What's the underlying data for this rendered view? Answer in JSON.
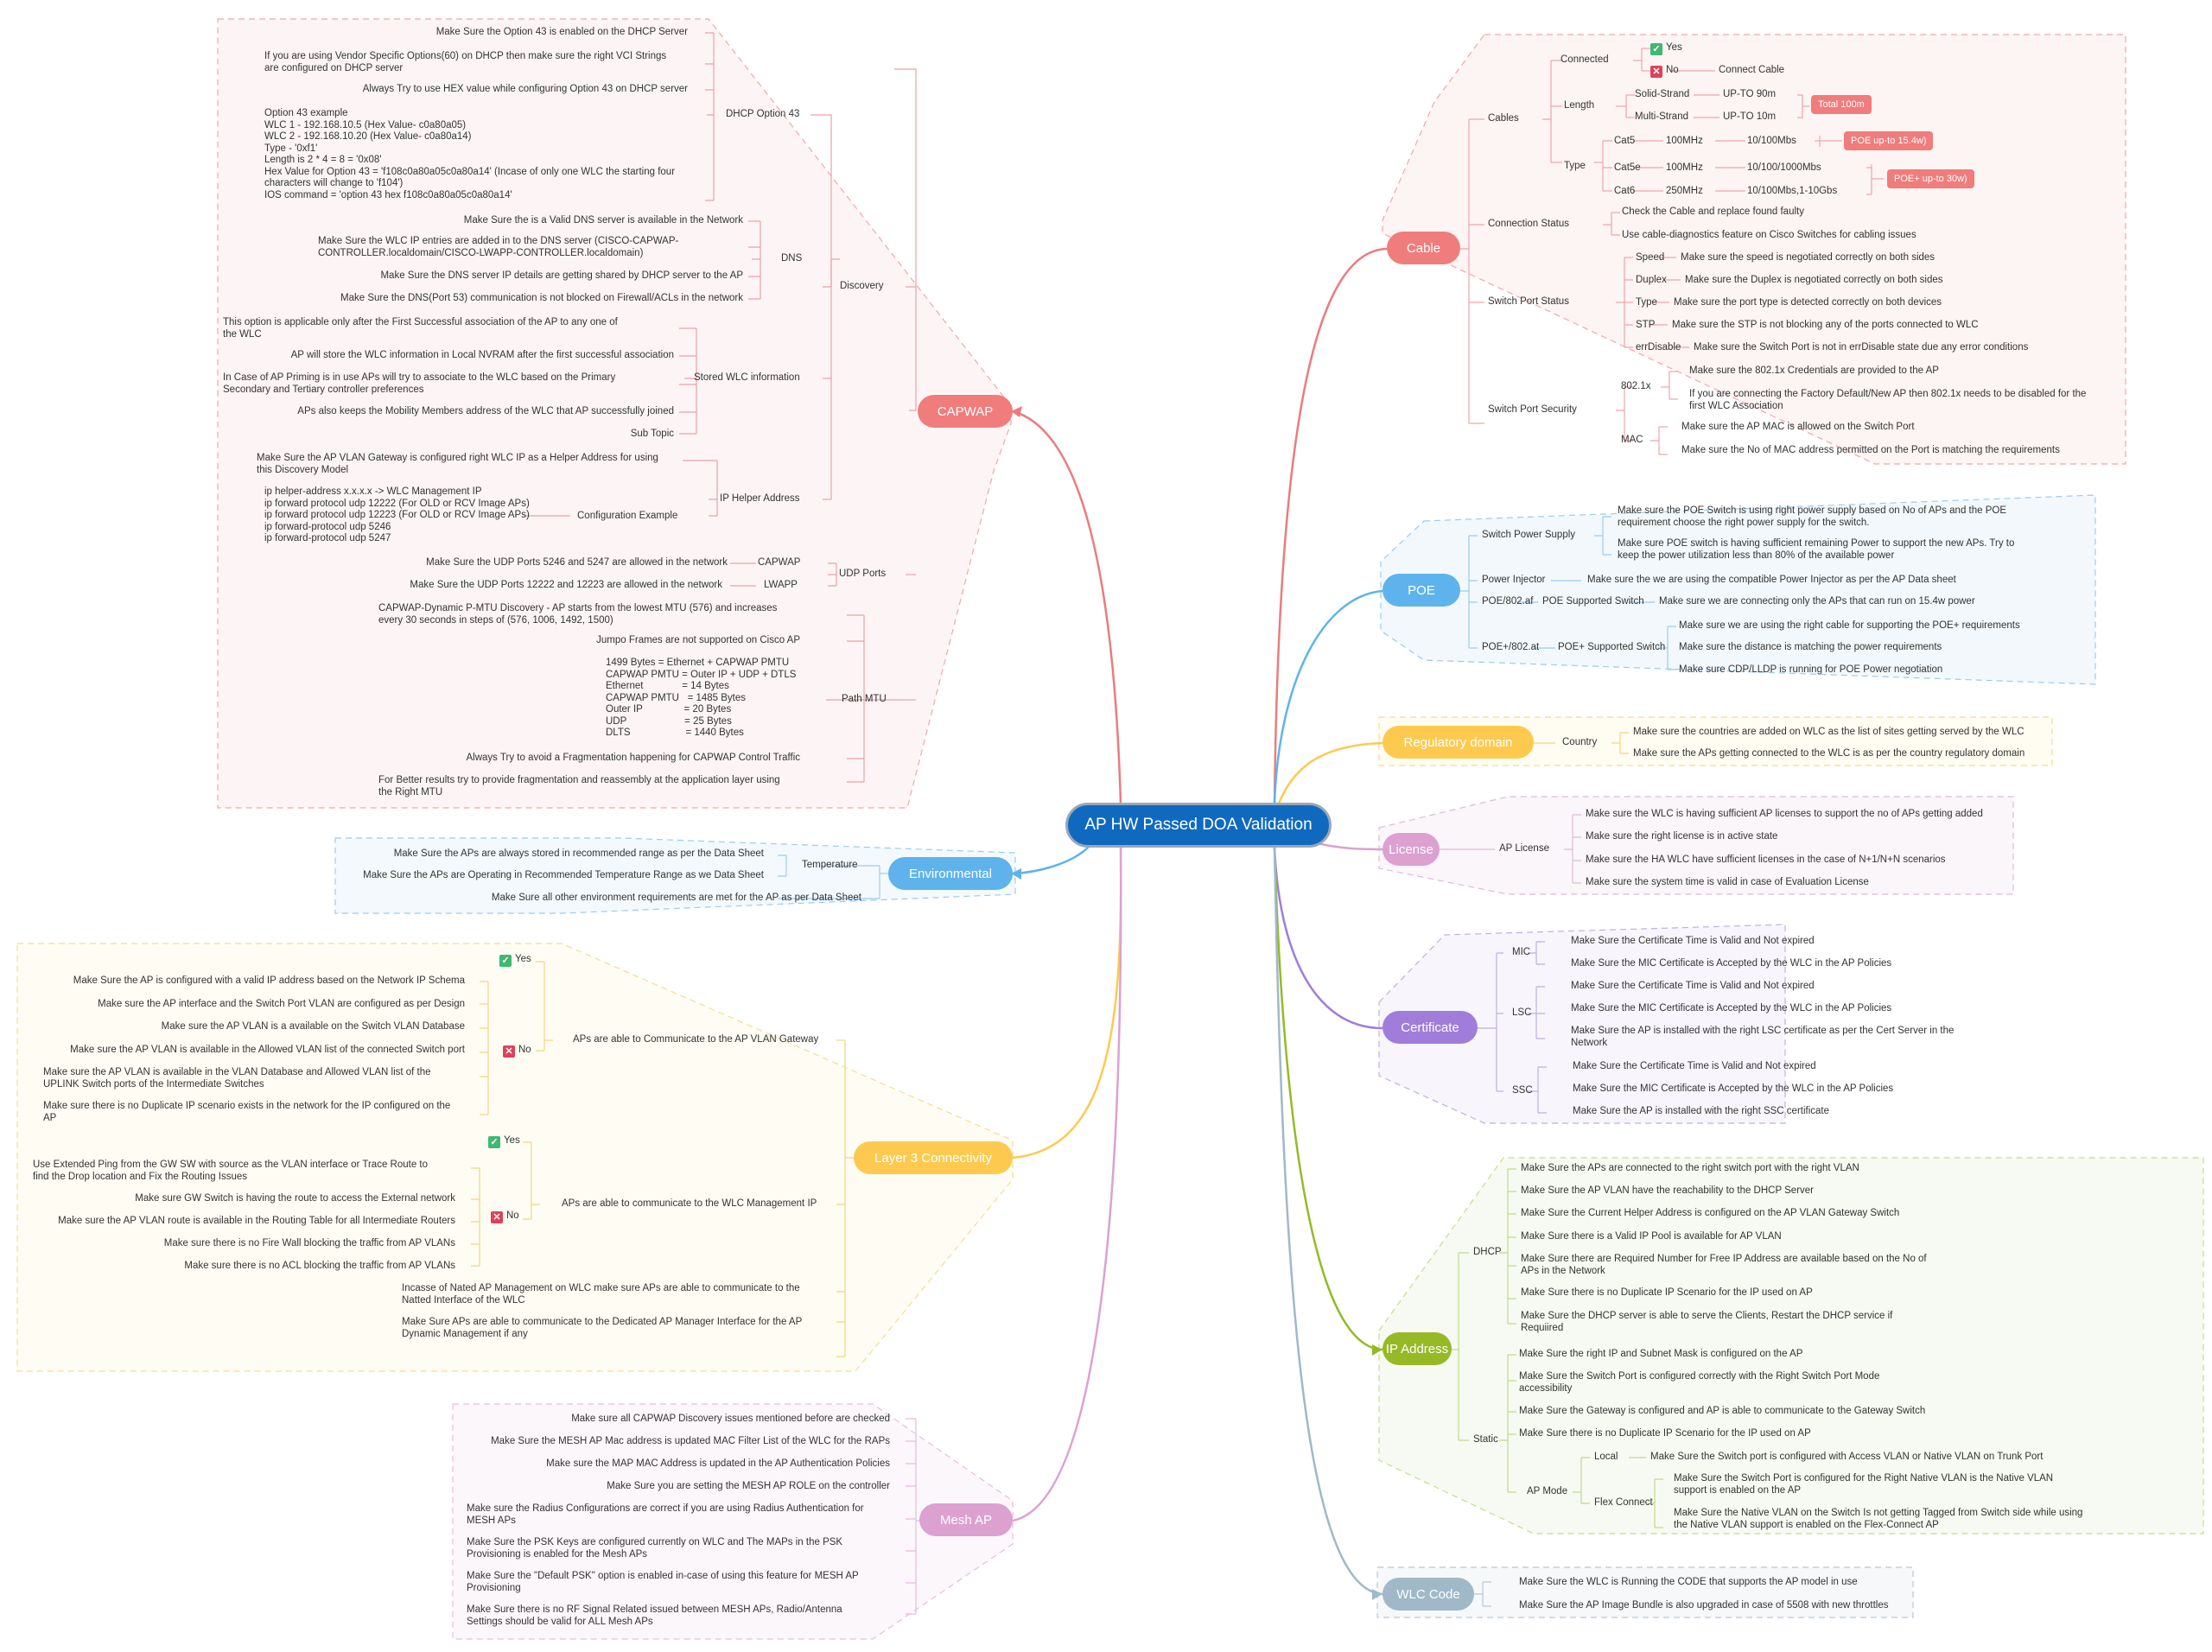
{
  "root": {
    "title": "AP HW Passed DOA Validation"
  },
  "colors": {
    "root": "#0f6abf",
    "capwap": "#f07c7c",
    "environmental": "#5fb3ec",
    "layer3": "#fdca4f",
    "mesh": "#dca1d1",
    "cable": "#f07c7c",
    "poe": "#5fb3ec",
    "regulatory": "#fdca4f",
    "license": "#dca1d1",
    "certificate": "#a07ddb",
    "ip": "#95ba26",
    "wlc": "#9fb9c8"
  },
  "capwap": {
    "label": "CAPWAP",
    "discovery": "Discovery",
    "dhcp43": {
      "label": "DHCP Option 43",
      "items": [
        "Make Sure the Option 43 is enabled on the DHCP Server",
        "If you are using Vendor Specific Options(60) on DHCP then make sure the right VCI Strings\nare configured on DHCP server",
        "Always Try to use HEX value while configuring Option 43 on DHCP server",
        "Option 43 example\nWLC 1 - 192.168.10.5 (Hex Value- c0a80a05)\nWLC 2 - 192.168.10.20 (Hex Value- c0a80a14)\nType - '0xf1'\nLength is 2 * 4 = 8 = '0x08'\nHex Value for Option 43 = 'f108c0a80a05c0a80a14' (Incase of only one WLC the starting four\ncharacters will change to 'f104')\nIOS command = 'option 43 hex f108c0a80a05c0a80a14'"
      ]
    },
    "dns": {
      "label": "DNS",
      "items": [
        "Make Sure the is a Valid DNS server is available in the Network",
        "Make Sure the WLC IP entries are added in to the DNS server (CISCO-CAPWAP-\nCONTROLLER.localdomain/CISCO-LWAPP-CONTROLLER.localdomain)",
        "Make Sure the DNS server IP details are getting shared by DHCP server to the AP",
        "Make Sure the DNS(Port 53) communication is not blocked on Firewall/ACLs in the network"
      ]
    },
    "stored": {
      "label": "Stored WLC information",
      "items": [
        "This option is applicable only after the First Successful association of the AP to any one of\nthe WLC",
        "AP will store the WLC information in Local NVRAM after the first successful association",
        "In Case of AP Priming is in use APs will try to associate to the WLC based on the Primary\nSecondary and Tertiary controller preferences",
        "APs also keeps the Mobility Members address of the WLC that AP successfully joined",
        "Sub Topic"
      ]
    },
    "helper": {
      "label": "IP Helper Address",
      "items": [
        "Make Sure the AP VLAN Gateway is configured right WLC IP as a Helper Address for using\nthis Discovery Model"
      ],
      "config_label": "Configuration Example",
      "config_text": "ip helper-address x.x.x.x -> WLC Management IP\nip forward protocol udp 12222 (For OLD or RCV Image APs)\nip forward protocol udp 12223 (For OLD or RCV Image APs)\nip forward-protocol udp 5246\nip forward-protocol udp 5247"
    },
    "udp": {
      "label": "UDP Ports",
      "capwap_label": "CAPWAP",
      "capwap_text": "Make Sure the UDP Ports 5246 and 5247 are allowed in the network",
      "lwapp_label": "LWAPP",
      "lwapp_text": "Make Sure the UDP Ports 12222 and 12223 are allowed in the network"
    },
    "pmtu": {
      "label": "Path MTU",
      "items": [
        "CAPWAP-Dynamic P-MTU Discovery - AP starts from the lowest MTU (576) and increases\nevery 30 seconds in steps of (576, 1006, 1492, 1500)",
        "Jumpo Frames are not supported on Cisco AP",
        "1499 Bytes = Ethernet + CAPWAP PMTU\nCAPWAP PMTU = Outer IP + UDP + DTLS\nEthernet              = 14 Bytes\nCAPWAP PMTU   = 1485 Bytes\nOuter IP               = 20 Bytes\nUDP                     = 25 Bytes\nDLTS                    = 1440 Bytes",
        "Always Try to avoid a Fragmentation happening for CAPWAP Control Traffic",
        "For Better results try to provide fragmentation and reassembly at the application layer using\nthe Right MTU"
      ]
    }
  },
  "environmental": {
    "label": "Environmental",
    "temperature": "Temperature",
    "temp_items": [
      "Make Sure the APs are always stored in recommended range as per the Data Sheet",
      "Make Sure the APs are Operating in Recommended Temperature Range as we Data Sheet"
    ],
    "other": "Make Sure all other environment requirements are met for the AP as per Data Sheet"
  },
  "layer3": {
    "label": "Layer 3 Connectivity",
    "gateway": {
      "label": "APs are able to Communicate to the AP VLAN Gateway",
      "yes": "Yes",
      "no": "No",
      "no_items": [
        "Make Sure the AP is configured with a valid IP address based on the Network IP Schema",
        "Make sure the AP interface and the Switch Port VLAN are configured as per Design",
        "Make sure the AP VLAN is a available on the Switch VLAN Database",
        "Make sure the AP VLAN is available in the Allowed VLAN list of the connected Switch port",
        "Make sure the AP VLAN is available in the VLAN Database and Allowed VLAN list of the\nUPLINK Switch ports of the Intermediate Switches",
        "Make sure there is no Duplicate IP scenario exists in the network for the IP configured on the\nAP"
      ]
    },
    "wlcmgmt": {
      "label": "APs are able to communicate to the WLC Management IP",
      "yes": "Yes",
      "no": "No",
      "no_items": [
        "Use Extended Ping from the GW SW with source as the VLAN interface or Trace Route to\nfind the Drop location and Fix the Routing Issues",
        "Make sure GW Switch is having the route to access the External network",
        "Make sure the AP VLAN route is available in the Routing Table for all Intermediate Routers",
        "Make sure there is no Fire Wall blocking the traffic from AP VLANs",
        "Make sure there is no ACL blocking the traffic from AP VLANs"
      ]
    },
    "nated": "Incasse of Nated AP Management on WLC make sure APs are able to communicate to the\nNatted Interface of the WLC",
    "dedicated": "Make Sure APs are able to communicate to the Dedicated AP Manager Interface for the AP\nDynamic Management if any"
  },
  "mesh": {
    "label": "Mesh AP",
    "items": [
      "Make sure all CAPWAP Discovery issues mentioned before are checked",
      "Make Sure the MESH AP Mac address is updated MAC Filter List of the WLC for the RAPs",
      "Make sure the MAP MAC Address is updated in the AP Authentication Policies",
      "Make Sure you are setting the MESH AP ROLE on the controller",
      "Make sure the Radius Configurations are correct if you are using Radius Authentication for\nMESH APs",
      "Make Sure the PSK Keys are configured currently on WLC and The MAPs in the PSK\nProvisioning is enabled for the Mesh APs",
      "Make Sure the \"Default PSK\" option is enabled in-case of using this feature for MESH AP\nProvisioning",
      "Make Sure there is no RF Signal Related issued between MESH APs, Radio/Antenna\nSettings should be valid for ALL Mesh APs"
    ]
  },
  "cable": {
    "label": "Cable",
    "cables": "Cables",
    "connected": "Connected",
    "yes": "Yes",
    "no": "No",
    "connect_cable": "Connect Cable",
    "length": "Length",
    "solid": "Solid-Strand",
    "solid_len": "UP-TO 90m",
    "multi": "Multi-Strand",
    "multi_len": "UP-TO 10m",
    "total": "Total 100m",
    "type": "Type",
    "types": [
      {
        "name": "Cat5",
        "freq": "100MHz",
        "speed": "10/100Mbs"
      },
      {
        "name": "Cat5e",
        "freq": "100MHz",
        "speed": "10/100/1000Mbs"
      },
      {
        "name": "Cat6",
        "freq": "250MHz",
        "speed": "10/100Mbs,1-10Gbs"
      }
    ],
    "poe_tag": "POE up-to 15.4w)",
    "poeplus_tag": "POE+ up-to 30w)",
    "conn_status": "Connection Status",
    "conn_items": [
      "Check the Cable and replace found faulty",
      "Use cable-diagnostics feature on Cisco Switches for cabling issues"
    ],
    "port_status": "Switch Port Status",
    "port_items": [
      {
        "k": "Speed",
        "v": "Make sure the speed is negotiated correctly on both sides"
      },
      {
        "k": "Duplex",
        "v": "Make sure the Duplex is negotiated correctly on both sides"
      },
      {
        "k": "Type",
        "v": "Make sure the port type is detected correctly on both devices"
      },
      {
        "k": "STP",
        "v": "Make sure the STP is not blocking any of the ports connected to WLC"
      },
      {
        "k": "errDisable",
        "v": "Make sure the Switch Port is not in errDisable state due any error conditions"
      }
    ],
    "port_security": "Switch Port Security",
    "dot1x": "802.1x",
    "dot1x_items": [
      "Make sure the 802.1x Credentials are provided to the AP",
      "If you are connecting the Factory Default/New AP then 802.1x needs to be disabled for the\nfirst WLC Association"
    ],
    "mac": "MAC",
    "mac_items": [
      "Make sure the AP MAC is allowed on the Switch Port",
      "Make sure the No of MAC address permitted on the Port is matching the requirements"
    ]
  },
  "poe": {
    "label": "POE",
    "sps": "Switch Power Supply",
    "sps_items": [
      "Make sure the POE Switch is using right power supply based on No of APs and the POE\nrequirement choose the right power supply for the switch.",
      "Make sure POE switch is having sufficient remaining Power to support the new APs. Try to\nkeep the power utilization less than 80% of the available power"
    ],
    "injector": "Power Injector",
    "injector_text": "Make sure the we are using the compatible Power Injector as per the AP Data sheet",
    "af": "POE/802.af",
    "af_switch": "POE Supported Switch",
    "af_text": "Make sure we are connecting only the APs that can run on 15.4w power",
    "at": "POE+/802.at",
    "at_switch": "POE+ Supported Switch",
    "at_items": [
      "Make sure we are using the right cable for supporting the POE+ requirements",
      "Make sure the distance is matching the power requirements",
      "Make sure CDP/LLDP is running for POE Power negotiation"
    ]
  },
  "regulatory": {
    "label": "Regulatory domain",
    "country": "Country",
    "items": [
      "Make sure the countries are added on WLC as the list of sites getting served by the WLC",
      "Make sure the APs getting connected to the WLC is as per the country regulatory domain"
    ]
  },
  "license": {
    "label": "License",
    "ap_license": "AP License",
    "items": [
      "Make sure the WLC is having sufficient AP licenses to support the no of APs getting added",
      "Make sure the right license is in active state",
      "Make sure the HA WLC have sufficient licenses in the case of N+1/N+N scenarios",
      "Make sure the system time is valid in case of Evaluation License"
    ]
  },
  "certificate": {
    "label": "Certificate",
    "mic": "MIC",
    "mic_items": [
      "Make Sure the Certificate Time is Valid and Not expired",
      "Make Sure the MIC Certificate is Accepted by the WLC in the AP Policies"
    ],
    "lsc": "LSC",
    "lsc_items": [
      "Make Sure the Certificate Time is Valid and Not expired",
      "Make Sure the MIC Certificate is Accepted by the WLC in the AP Policies",
      "Make Sure the AP is installed with the right LSC certificate as per the Cert Server in the\nNetwork"
    ],
    "ssc": "SSC",
    "ssc_items": [
      "Make Sure the Certificate Time is Valid and Not expired",
      "Make Sure the MIC Certificate is Accepted by the WLC in the AP Policies",
      "Make Sure the AP is installed with the right SSC certificate"
    ]
  },
  "ip": {
    "label": "IP Address",
    "dhcp": "DHCP",
    "dhcp_items": [
      "Make Sure the APs are connected to the right switch port with the right VLAN",
      "Make Sure the AP VLAN have the reachability to the DHCP Server",
      "Make Sure the Current Helper Address is configured on the AP VLAN Gateway Switch",
      "Make Sure there is a Valid IP Pool is available for AP VLAN",
      "Make Sure there are Required Number for Free IP Address are available based on the No of\nAPs in the Network",
      "Make Sure there is no Duplicate IP Scenario for the IP used on AP",
      "Make Sure the DHCP server is able to serve the Clients, Restart the DHCP service if\nRequiired"
    ],
    "static": "Static",
    "static_items": [
      "Make Sure the right IP and Subnet Mask is configured on the AP",
      "Make Sure the Switch Port is configured correctly with the Right Switch Port Mode\naccessibility",
      "Make Sure the Gateway is configured and AP is able to communicate to the Gateway Switch",
      "Make Sure there is no Duplicate IP Scenario for the IP used on AP"
    ],
    "apmode": "AP Mode",
    "local": "Local",
    "local_text": "Make Sure the Switch port is configured with Access VLAN or Native VLAN on Trunk Port",
    "flex": "Flex Connect",
    "flex_items": [
      "Make Sure the Switch Port is configured for the Right Native VLAN is the Native VLAN\nsupport is enabled on the AP",
      "Make Sure the Native VLAN on the Switch Is not getting Tagged from Switch side while using\nthe Native VLAN support is enabled on the Flex-Connect AP"
    ]
  },
  "wlc": {
    "label": "WLC Code",
    "items": [
      "Make Sure the WLC is Running the CODE that supports the AP model in use",
      "Make Sure the AP Image Bundle is also upgraded in case of 5508 with new throttles"
    ]
  }
}
